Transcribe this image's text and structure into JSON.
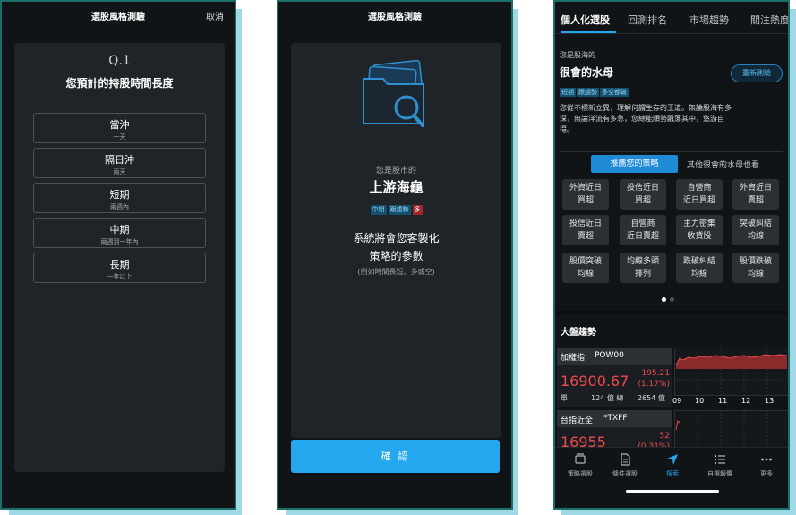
{
  "screen1": {
    "header_title": "選股風格測驗",
    "cancel_label": "取消",
    "question_number": "Q.1",
    "question_text": "您預計的持股時間長度",
    "options": [
      {
        "label": "當沖",
        "sub": "一天"
      },
      {
        "label": "隔日沖",
        "sub": "兩天"
      },
      {
        "label": "短期",
        "sub": "兩週內"
      },
      {
        "label": "中期",
        "sub": "兩週到一年內"
      },
      {
        "label": "長期",
        "sub": "一年以上"
      }
    ]
  },
  "screen2": {
    "header_title": "選股風格測驗",
    "you_are": "您是股市的",
    "persona_name": "上游海龜",
    "tags": [
      "中期",
      "跟趨勢",
      "多"
    ],
    "custom_line1": "系統將會您客製化",
    "custom_line2": "策略的參數",
    "custom_hint": "(例如時間長短、多或空)",
    "confirm_label": "確 認"
  },
  "screen3": {
    "tabs": [
      "個人化選股",
      "回測排名",
      "市場趨勢",
      "關注熱度"
    ],
    "you_are": "您是股海的",
    "persona_name": "很會的水母",
    "tags": [
      "短期",
      "跟趨勢",
      "多空都做"
    ],
    "retest_label": "重新測驗",
    "description_lines": [
      "您從不標新立異，理解何謂生存的王道。無論股海有多",
      "深，無論洋流有多急，您總能順勢飄蕩其中，悠游自",
      "得。"
    ],
    "recommend_tab": "推薦您的策略",
    "other_tab": "其他很會的水母也看",
    "strategies": [
      [
        "外資近日",
        "買超"
      ],
      [
        "投信近日",
        "買超"
      ],
      [
        "自營商",
        "近日買超"
      ],
      [
        "外資近日",
        "賣超"
      ],
      [
        "投信近日",
        "賣超"
      ],
      [
        "自營商",
        "近日賣超"
      ],
      [
        "主力密集",
        "收貨股"
      ],
      [
        "突破糾結",
        "均線"
      ],
      [
        "股價突破",
        "均線"
      ],
      [
        "均線多頭",
        "排列"
      ],
      [
        "跌破糾結",
        "均線"
      ],
      [
        "股價跌破",
        "均線"
      ]
    ],
    "market_title": "大盤趨勢",
    "indices": [
      {
        "name": "加權指",
        "code": "POW00",
        "value": "16900.67",
        "change": "195.21",
        "change_pct": "(1.17%)",
        "foot_label": "單",
        "foot_amount": "124 億 總",
        "foot_total": "2654 億"
      },
      {
        "name": "台指近全",
        "code": "*TXFF",
        "value": "16955",
        "change": "52",
        "change_pct": "(0.31%)"
      }
    ],
    "chart_ticks": [
      "09",
      "10",
      "11",
      "12",
      "13"
    ],
    "nav": [
      {
        "label": "策略選股",
        "icon": "stack-icon"
      },
      {
        "label": "條件選股",
        "icon": "checklist-icon"
      },
      {
        "label": "探索",
        "icon": "navigate-icon"
      },
      {
        "label": "自選報價",
        "icon": "list-icon"
      },
      {
        "label": "更多",
        "icon": "more-icon"
      }
    ],
    "colors": {
      "accent": "#25a7ef",
      "up": "#ef4a4a"
    }
  }
}
